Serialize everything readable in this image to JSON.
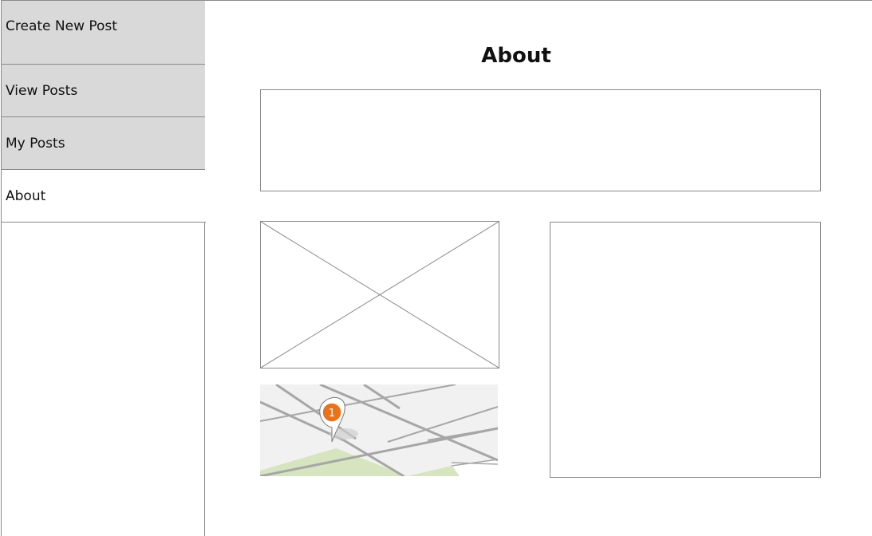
{
  "sidebar": {
    "items": [
      {
        "label": "Create New Post",
        "active": false
      },
      {
        "label": "View Posts",
        "active": false
      },
      {
        "label": "My Posts",
        "active": false
      },
      {
        "label": "About",
        "active": true
      }
    ]
  },
  "main": {
    "title": "About",
    "map": {
      "marker_label": "1",
      "marker_color": "#e8731a"
    }
  },
  "colors": {
    "nav_bg": "#d9d9d9",
    "border": "#8a8a8a",
    "map_road": "#a6a6a6",
    "map_park": "#d6e4bf"
  }
}
